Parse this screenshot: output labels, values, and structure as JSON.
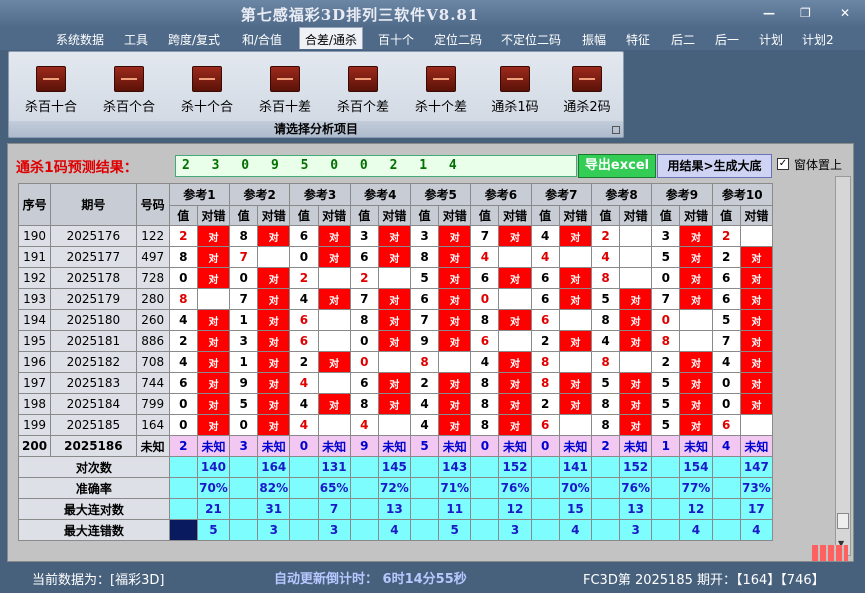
{
  "app": {
    "title": "第七感福彩3D排列三软件V8.81"
  },
  "menu": [
    "系统数据",
    "工具",
    "跨度/复式",
    "和/合值",
    "合差/通杀",
    "百十个",
    "定位二码",
    "不定位二码",
    "振幅",
    "特征",
    "后二",
    "后一",
    "计划",
    "计划2"
  ],
  "ribbon": {
    "buttons": [
      "杀百十合",
      "杀百个合",
      "杀十个合",
      "杀百十差",
      "杀百个差",
      "杀十个差",
      "通杀1码",
      "通杀2码"
    ],
    "caption": "请选择分析项目"
  },
  "prediction": {
    "label": "通杀1码预测结果：",
    "value": "2 3 0 9 5 0 0 2 1 4",
    "export_label": "导出excel",
    "result_label": "用结果>生成大底",
    "topmost_label": "窗体置上"
  },
  "table": {
    "headers": [
      "序号",
      "期号",
      "号码"
    ],
    "refs": [
      "参考1",
      "参考2",
      "参考3",
      "参考4",
      "参考5",
      "参考6",
      "参考7",
      "参考8",
      "参考9",
      "参考10"
    ],
    "sub_value": "值",
    "sub_check": "对错",
    "hit_text": "对",
    "rows": [
      {
        "seq": "190",
        "issue": "2025176",
        "num": "122",
        "vals": [
          "2",
          "8",
          "6",
          "3",
          "3",
          "7",
          "4",
          "2",
          "3",
          "2"
        ],
        "hits": [
          1,
          1,
          1,
          1,
          1,
          1,
          1,
          0,
          1,
          0
        ],
        "red": [
          1,
          0,
          0,
          0,
          0,
          0,
          0,
          1,
          0,
          1
        ]
      },
      {
        "seq": "191",
        "issue": "2025177",
        "num": "497",
        "vals": [
          "8",
          "7",
          "0",
          "6",
          "8",
          "4",
          "4",
          "4",
          "5",
          "2"
        ],
        "hits": [
          1,
          0,
          1,
          1,
          1,
          0,
          0,
          0,
          1,
          1
        ],
        "red": [
          0,
          1,
          0,
          0,
          0,
          1,
          1,
          1,
          0,
          0
        ]
      },
      {
        "seq": "192",
        "issue": "2025178",
        "num": "728",
        "vals": [
          "0",
          "0",
          "2",
          "2",
          "5",
          "6",
          "6",
          "8",
          "0",
          "6"
        ],
        "hits": [
          1,
          1,
          0,
          0,
          1,
          1,
          1,
          0,
          1,
          1
        ],
        "red": [
          0,
          0,
          1,
          1,
          0,
          0,
          0,
          1,
          0,
          0
        ]
      },
      {
        "seq": "193",
        "issue": "2025179",
        "num": "280",
        "vals": [
          "8",
          "7",
          "4",
          "7",
          "6",
          "0",
          "6",
          "5",
          "7",
          "6"
        ],
        "hits": [
          0,
          1,
          1,
          1,
          1,
          0,
          1,
          1,
          1,
          1
        ],
        "red": [
          1,
          0,
          0,
          0,
          0,
          1,
          0,
          0,
          0,
          0
        ]
      },
      {
        "seq": "194",
        "issue": "2025180",
        "num": "260",
        "vals": [
          "4",
          "1",
          "6",
          "8",
          "7",
          "8",
          "6",
          "8",
          "0",
          "5"
        ],
        "hits": [
          1,
          1,
          0,
          1,
          1,
          1,
          0,
          1,
          0,
          1
        ],
        "red": [
          0,
          0,
          1,
          0,
          0,
          0,
          1,
          0,
          1,
          0
        ]
      },
      {
        "seq": "195",
        "issue": "2025181",
        "num": "886",
        "vals": [
          "2",
          "3",
          "6",
          "0",
          "9",
          "6",
          "2",
          "4",
          "8",
          "7"
        ],
        "hits": [
          1,
          1,
          0,
          1,
          1,
          0,
          1,
          1,
          0,
          1
        ],
        "red": [
          0,
          0,
          1,
          0,
          0,
          1,
          0,
          0,
          1,
          0
        ]
      },
      {
        "seq": "196",
        "issue": "2025182",
        "num": "708",
        "vals": [
          "4",
          "1",
          "2",
          "0",
          "8",
          "4",
          "8",
          "8",
          "2",
          "4"
        ],
        "hits": [
          1,
          1,
          1,
          0,
          0,
          1,
          0,
          0,
          1,
          1
        ],
        "red": [
          0,
          0,
          0,
          1,
          1,
          0,
          1,
          1,
          0,
          0
        ]
      },
      {
        "seq": "197",
        "issue": "2025183",
        "num": "744",
        "vals": [
          "6",
          "9",
          "4",
          "6",
          "2",
          "8",
          "8",
          "5",
          "5",
          "0"
        ],
        "hits": [
          1,
          1,
          0,
          1,
          1,
          1,
          1,
          1,
          1,
          1
        ],
        "red": [
          0,
          0,
          1,
          0,
          0,
          0,
          1,
          0,
          0,
          0
        ]
      },
      {
        "seq": "198",
        "issue": "2025184",
        "num": "799",
        "vals": [
          "0",
          "5",
          "4",
          "8",
          "4",
          "8",
          "2",
          "8",
          "5",
          "0"
        ],
        "hits": [
          1,
          1,
          1,
          1,
          1,
          1,
          1,
          1,
          1,
          1
        ],
        "red": [
          0,
          0,
          0,
          0,
          0,
          0,
          0,
          0,
          0,
          0
        ]
      },
      {
        "seq": "199",
        "issue": "2025185",
        "num": "164",
        "vals": [
          "0",
          "0",
          "4",
          "4",
          "4",
          "8",
          "6",
          "8",
          "5",
          "6"
        ],
        "hits": [
          1,
          1,
          0,
          0,
          1,
          1,
          0,
          1,
          1,
          0
        ],
        "red": [
          0,
          0,
          1,
          1,
          0,
          0,
          1,
          0,
          0,
          1
        ]
      }
    ],
    "pending": {
      "seq": "200",
      "issue": "2025186",
      "num": "未知",
      "vals": [
        "2",
        "3",
        "0",
        "9",
        "5",
        "0",
        "0",
        "2",
        "1",
        "4"
      ],
      "unknown": "未知"
    },
    "stats": [
      {
        "label": "对次数",
        "values": [
          "140",
          "164",
          "131",
          "145",
          "143",
          "152",
          "141",
          "152",
          "154",
          "147"
        ]
      },
      {
        "label": "准确率",
        "values": [
          "70%",
          "82%",
          "65%",
          "72%",
          "71%",
          "76%",
          "70%",
          "76%",
          "77%",
          "73%"
        ]
      },
      {
        "label": "最大连对数",
        "values": [
          "21",
          "31",
          "7",
          "13",
          "11",
          "12",
          "15",
          "13",
          "12",
          "17"
        ]
      },
      {
        "label": "最大连错数",
        "values": [
          "5",
          "3",
          "3",
          "4",
          "5",
          "3",
          "4",
          "3",
          "4",
          "4"
        ]
      }
    ]
  },
  "status": {
    "left": "当前数据为：[福彩3D]",
    "countdown": "自动更新倒计时：  6时14分55秒",
    "right": "FC3D第 2025185 期开：【164】【746】"
  },
  "colors": {
    "hit": "#ff0000",
    "stat_bg": "#7dfdfd",
    "pending_bg": "#f2c8f2",
    "export_bg": "#33cc55"
  }
}
